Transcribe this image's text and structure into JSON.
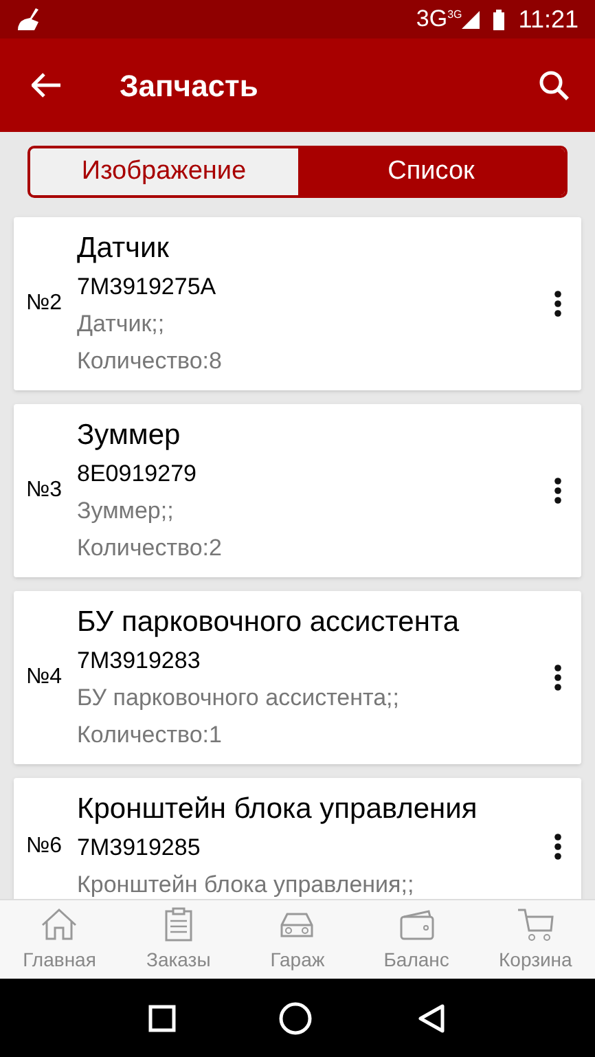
{
  "status_bar": {
    "network": "3G",
    "network_small": "3G",
    "time": "11:21"
  },
  "app_bar": {
    "title": "Запчасть"
  },
  "view_tabs": [
    {
      "label": "Изображение",
      "selected": false
    },
    {
      "label": "Список",
      "selected": true
    }
  ],
  "parts": [
    {
      "number": "№2",
      "name": "Датчик",
      "code": "7M3919275A",
      "description": "Датчик;;",
      "quantity": "Количество:8"
    },
    {
      "number": "№3",
      "name": "Зуммер",
      "code": "8E0919279",
      "description": "Зуммер;;",
      "quantity": "Количество:2"
    },
    {
      "number": "№4",
      "name": "БУ парковочного ассистента",
      "code": "7M3919283",
      "description": "БУ парковочного ассистента;;",
      "quantity": "Количество:1"
    },
    {
      "number": "№6",
      "name": "Кронштейн блока управления",
      "code": "7M3919285",
      "description": "Кронштейн блока управления;;"
    }
  ],
  "bottom_nav": [
    {
      "label": "Главная",
      "kind": "home"
    },
    {
      "label": "Заказы",
      "kind": "orders"
    },
    {
      "label": "Гараж",
      "kind": "garage"
    },
    {
      "label": "Баланс",
      "kind": "balance"
    },
    {
      "label": "Корзина",
      "kind": "cart"
    }
  ]
}
